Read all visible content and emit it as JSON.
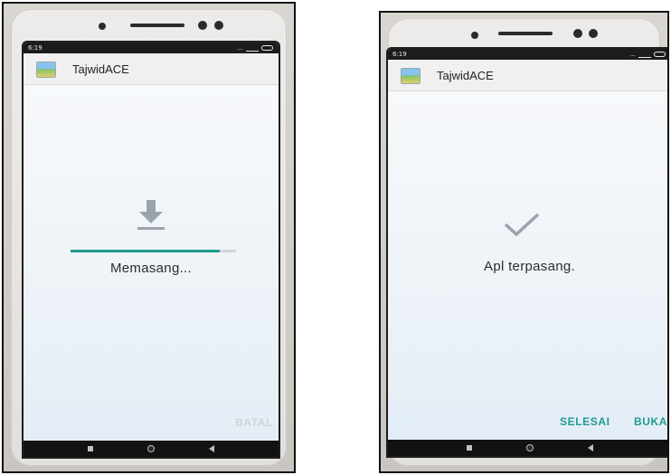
{
  "left_screen": {
    "status_time": "6:19",
    "status_dots": "...",
    "battery": "55",
    "app_title": "TajwidACE",
    "app_icon": "app-landscape-icon",
    "state_icon": "download-icon",
    "progress_percent": 90,
    "status_text": "Memasang...",
    "cancel_label": "BATAL",
    "cancel_color": "#d0d3d7",
    "accent_color": "#1e9b8e"
  },
  "right_screen": {
    "status_time": "6:19",
    "status_dots": "...",
    "battery": "55",
    "app_title": "TajwidACE",
    "app_icon": "app-landscape-icon",
    "state_icon": "checkmark-icon",
    "status_text": "Apl terpasang.",
    "done_label": "SELESAI",
    "open_label": "BUKA",
    "accent_color": "#1e9b8e"
  },
  "nav_icons": [
    "recents-square-icon",
    "home-circle-icon",
    "back-triangle-icon"
  ]
}
